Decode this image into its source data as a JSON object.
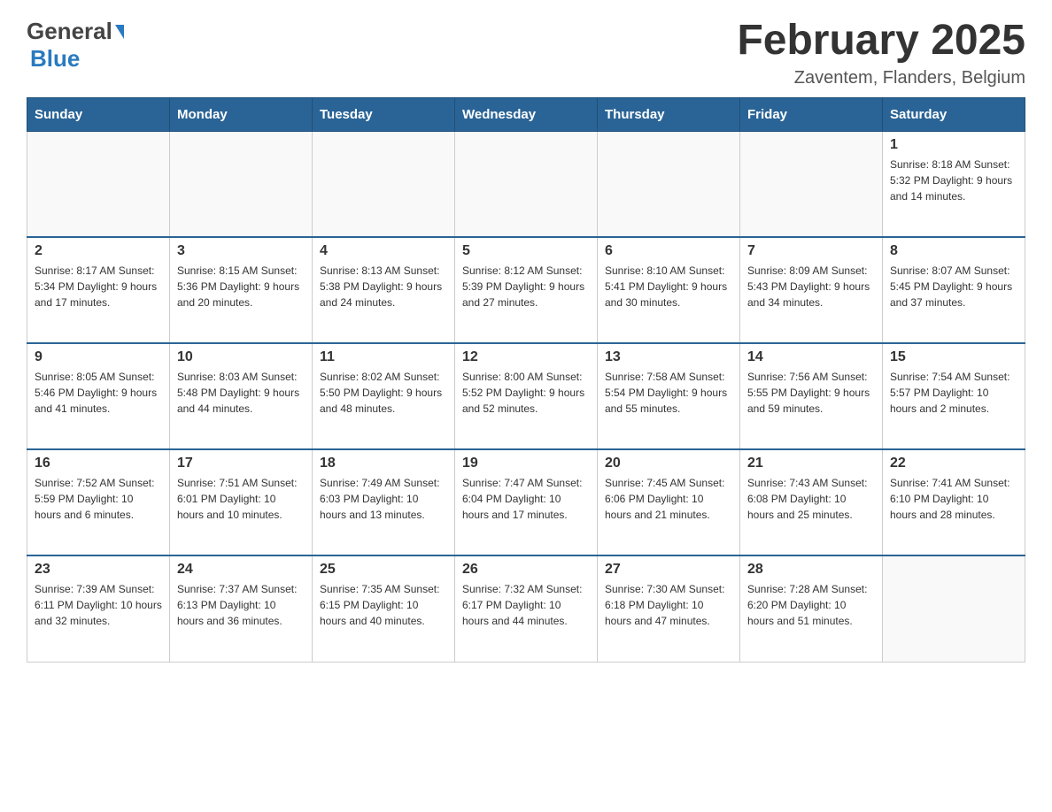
{
  "header": {
    "month_title": "February 2025",
    "location": "Zaventem, Flanders, Belgium",
    "logo_general": "General",
    "logo_blue": "Blue"
  },
  "weekdays": [
    "Sunday",
    "Monday",
    "Tuesday",
    "Wednesday",
    "Thursday",
    "Friday",
    "Saturday"
  ],
  "weeks": [
    [
      {
        "day": "",
        "info": ""
      },
      {
        "day": "",
        "info": ""
      },
      {
        "day": "",
        "info": ""
      },
      {
        "day": "",
        "info": ""
      },
      {
        "day": "",
        "info": ""
      },
      {
        "day": "",
        "info": ""
      },
      {
        "day": "1",
        "info": "Sunrise: 8:18 AM\nSunset: 5:32 PM\nDaylight: 9 hours and 14 minutes."
      }
    ],
    [
      {
        "day": "2",
        "info": "Sunrise: 8:17 AM\nSunset: 5:34 PM\nDaylight: 9 hours and 17 minutes."
      },
      {
        "day": "3",
        "info": "Sunrise: 8:15 AM\nSunset: 5:36 PM\nDaylight: 9 hours and 20 minutes."
      },
      {
        "day": "4",
        "info": "Sunrise: 8:13 AM\nSunset: 5:38 PM\nDaylight: 9 hours and 24 minutes."
      },
      {
        "day": "5",
        "info": "Sunrise: 8:12 AM\nSunset: 5:39 PM\nDaylight: 9 hours and 27 minutes."
      },
      {
        "day": "6",
        "info": "Sunrise: 8:10 AM\nSunset: 5:41 PM\nDaylight: 9 hours and 30 minutes."
      },
      {
        "day": "7",
        "info": "Sunrise: 8:09 AM\nSunset: 5:43 PM\nDaylight: 9 hours and 34 minutes."
      },
      {
        "day": "8",
        "info": "Sunrise: 8:07 AM\nSunset: 5:45 PM\nDaylight: 9 hours and 37 minutes."
      }
    ],
    [
      {
        "day": "9",
        "info": "Sunrise: 8:05 AM\nSunset: 5:46 PM\nDaylight: 9 hours and 41 minutes."
      },
      {
        "day": "10",
        "info": "Sunrise: 8:03 AM\nSunset: 5:48 PM\nDaylight: 9 hours and 44 minutes."
      },
      {
        "day": "11",
        "info": "Sunrise: 8:02 AM\nSunset: 5:50 PM\nDaylight: 9 hours and 48 minutes."
      },
      {
        "day": "12",
        "info": "Sunrise: 8:00 AM\nSunset: 5:52 PM\nDaylight: 9 hours and 52 minutes."
      },
      {
        "day": "13",
        "info": "Sunrise: 7:58 AM\nSunset: 5:54 PM\nDaylight: 9 hours and 55 minutes."
      },
      {
        "day": "14",
        "info": "Sunrise: 7:56 AM\nSunset: 5:55 PM\nDaylight: 9 hours and 59 minutes."
      },
      {
        "day": "15",
        "info": "Sunrise: 7:54 AM\nSunset: 5:57 PM\nDaylight: 10 hours and 2 minutes."
      }
    ],
    [
      {
        "day": "16",
        "info": "Sunrise: 7:52 AM\nSunset: 5:59 PM\nDaylight: 10 hours and 6 minutes."
      },
      {
        "day": "17",
        "info": "Sunrise: 7:51 AM\nSunset: 6:01 PM\nDaylight: 10 hours and 10 minutes."
      },
      {
        "day": "18",
        "info": "Sunrise: 7:49 AM\nSunset: 6:03 PM\nDaylight: 10 hours and 13 minutes."
      },
      {
        "day": "19",
        "info": "Sunrise: 7:47 AM\nSunset: 6:04 PM\nDaylight: 10 hours and 17 minutes."
      },
      {
        "day": "20",
        "info": "Sunrise: 7:45 AM\nSunset: 6:06 PM\nDaylight: 10 hours and 21 minutes."
      },
      {
        "day": "21",
        "info": "Sunrise: 7:43 AM\nSunset: 6:08 PM\nDaylight: 10 hours and 25 minutes."
      },
      {
        "day": "22",
        "info": "Sunrise: 7:41 AM\nSunset: 6:10 PM\nDaylight: 10 hours and 28 minutes."
      }
    ],
    [
      {
        "day": "23",
        "info": "Sunrise: 7:39 AM\nSunset: 6:11 PM\nDaylight: 10 hours and 32 minutes."
      },
      {
        "day": "24",
        "info": "Sunrise: 7:37 AM\nSunset: 6:13 PM\nDaylight: 10 hours and 36 minutes."
      },
      {
        "day": "25",
        "info": "Sunrise: 7:35 AM\nSunset: 6:15 PM\nDaylight: 10 hours and 40 minutes."
      },
      {
        "day": "26",
        "info": "Sunrise: 7:32 AM\nSunset: 6:17 PM\nDaylight: 10 hours and 44 minutes."
      },
      {
        "day": "27",
        "info": "Sunrise: 7:30 AM\nSunset: 6:18 PM\nDaylight: 10 hours and 47 minutes."
      },
      {
        "day": "28",
        "info": "Sunrise: 7:28 AM\nSunset: 6:20 PM\nDaylight: 10 hours and 51 minutes."
      },
      {
        "day": "",
        "info": ""
      }
    ]
  ]
}
